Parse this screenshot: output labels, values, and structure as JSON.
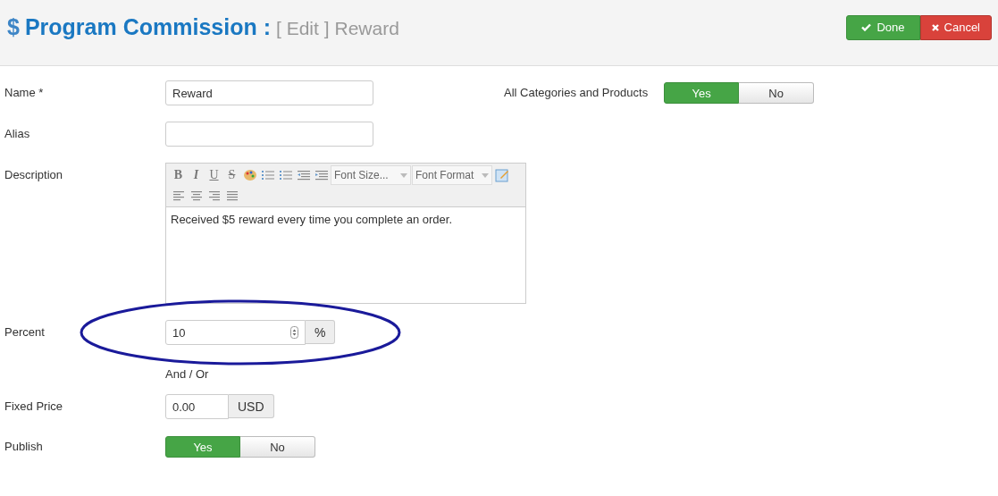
{
  "header": {
    "icon": "$",
    "title": "Program Commission :",
    "mode": "[ Edit ]",
    "subtitle": "Reward"
  },
  "actions": [
    {
      "kind": "done",
      "label": "Done"
    },
    {
      "kind": "cancel",
      "label": "Cancel"
    }
  ],
  "scope": {
    "label": "All Categories and Products",
    "options": [
      {
        "label": "Yes",
        "selected": true
      },
      {
        "label": "No",
        "selected": false
      }
    ]
  },
  "fields": [
    {
      "kind": "text",
      "label": "Name *",
      "value": "Reward"
    },
    {
      "kind": "text",
      "label": "Alias"
    },
    {
      "kind": "editor",
      "label": "Description",
      "toolbar": [
        {
          "kind": "bold",
          "label": "B"
        },
        {
          "kind": "italic",
          "label": "I"
        },
        {
          "kind": "underline",
          "label": "U"
        },
        {
          "kind": "strike",
          "label": "S"
        },
        {
          "kind": "palette"
        },
        {
          "kind": "ordered-list"
        },
        {
          "kind": "bullet-list"
        },
        {
          "kind": "outdent"
        },
        {
          "kind": "indent"
        },
        {
          "kind": "select",
          "label": "Font Size..."
        },
        {
          "kind": "select",
          "label": "Font Format"
        },
        {
          "kind": "edit-image"
        },
        {
          "kind": "break"
        },
        {
          "kind": "align-left"
        },
        {
          "kind": "align-center"
        },
        {
          "kind": "align-right"
        },
        {
          "kind": "justify"
        }
      ],
      "value": "Received $5 reward every time you complete an order."
    },
    {
      "kind": "number",
      "label": "Percent",
      "value": "10",
      "addon": "%",
      "annotated": true
    },
    {
      "kind": "note",
      "text": "And / Or"
    },
    {
      "kind": "addon",
      "label": "Fixed Price",
      "value": "0.00",
      "addon": "USD"
    },
    {
      "kind": "toggle",
      "label": "Publish",
      "options": [
        {
          "label": "Yes",
          "selected": true
        },
        {
          "label": "No",
          "selected": false
        }
      ]
    }
  ]
}
